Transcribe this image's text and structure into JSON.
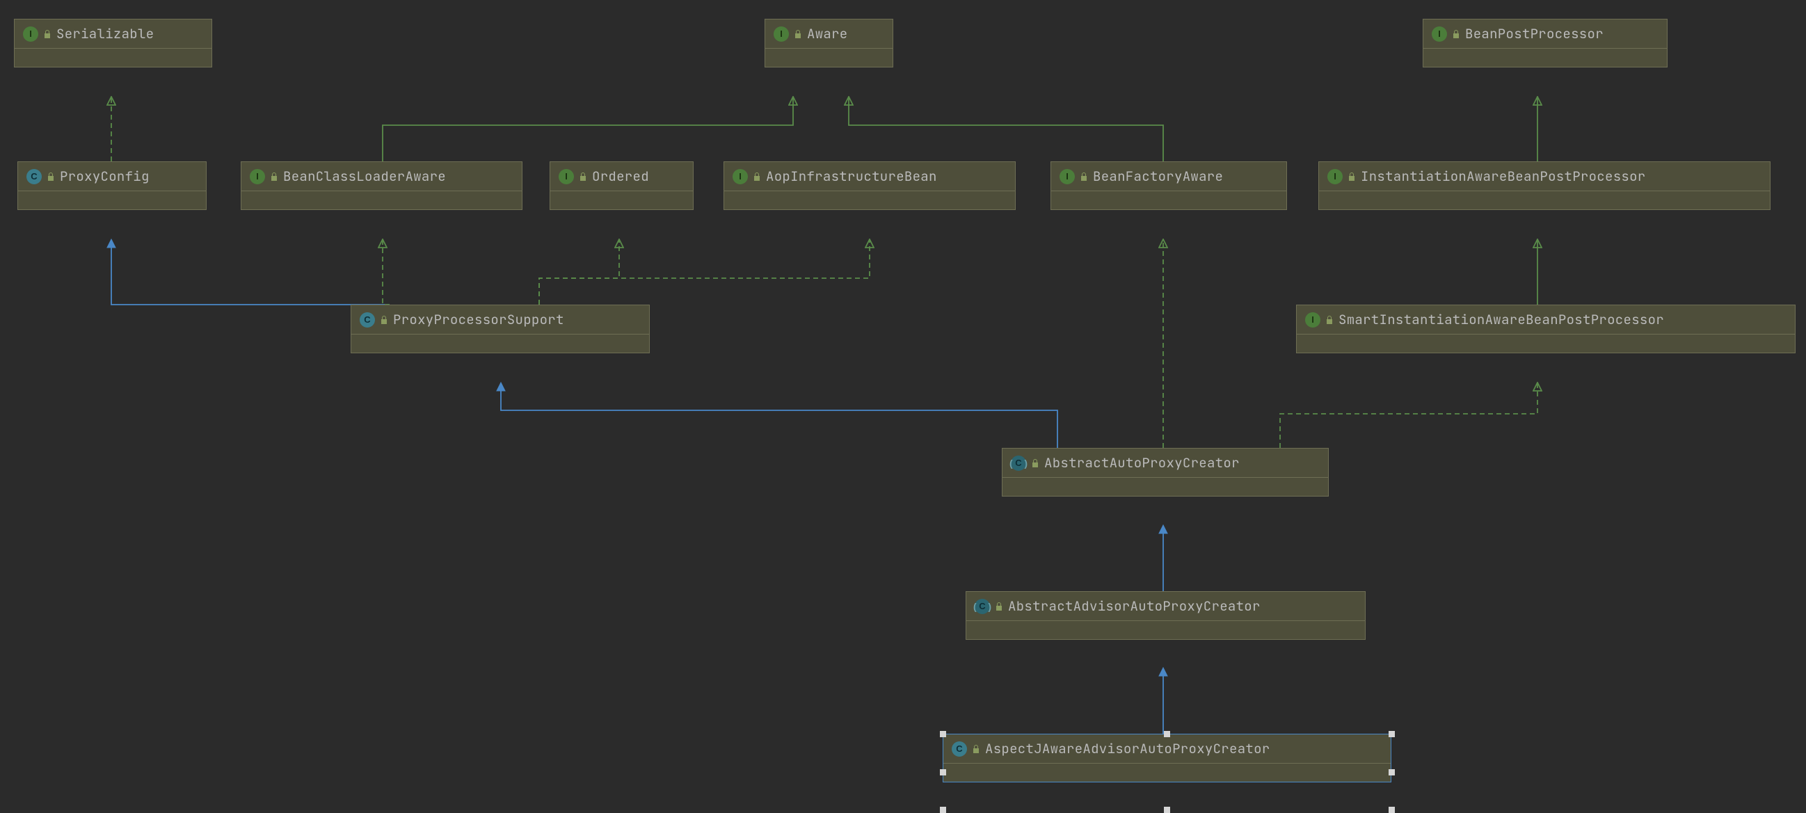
{
  "diagram_type": "UML Class Hierarchy",
  "colors": {
    "background": "#2b2b2b",
    "node_bg": "#4e4e3a",
    "node_border": "#6e6e54",
    "interface_icon": "#4b7d3a",
    "class_icon": "#3a7d8c",
    "extends_line": "#4a88c7",
    "implements_line": "#5a8c4a",
    "selection_border": "#4a88c7"
  },
  "nodes": {
    "serializable": {
      "name": "Serializable",
      "kind": "interface"
    },
    "aware": {
      "name": "Aware",
      "kind": "interface"
    },
    "beanPostProcessor": {
      "name": "BeanPostProcessor",
      "kind": "interface"
    },
    "proxyConfig": {
      "name": "ProxyConfig",
      "kind": "class"
    },
    "beanClassLoaderAware": {
      "name": "BeanClassLoaderAware",
      "kind": "interface"
    },
    "ordered": {
      "name": "Ordered",
      "kind": "interface"
    },
    "aopInfrastructureBean": {
      "name": "AopInfrastructureBean",
      "kind": "interface"
    },
    "beanFactoryAware": {
      "name": "BeanFactoryAware",
      "kind": "interface"
    },
    "instantiationAwareBeanPostProcessor": {
      "name": "InstantiationAwareBeanPostProcessor",
      "kind": "interface"
    },
    "proxyProcessorSupport": {
      "name": "ProxyProcessorSupport",
      "kind": "class"
    },
    "smartInstantiationAwareBeanPostProcessor": {
      "name": "SmartInstantiationAwareBeanPostProcessor",
      "kind": "interface"
    },
    "abstractAutoProxyCreator": {
      "name": "AbstractAutoProxyCreator",
      "kind": "abstract-class"
    },
    "abstractAdvisorAutoProxyCreator": {
      "name": "AbstractAdvisorAutoProxyCreator",
      "kind": "abstract-class"
    },
    "aspectJAwareAdvisorAutoProxyCreator": {
      "name": "AspectJAwareAdvisorAutoProxyCreator",
      "kind": "class",
      "selected": true
    }
  },
  "edges": [
    {
      "from": "proxyConfig",
      "to": "serializable",
      "rel": "implements"
    },
    {
      "from": "beanClassLoaderAware",
      "to": "aware",
      "rel": "extends-interface"
    },
    {
      "from": "beanFactoryAware",
      "to": "aware",
      "rel": "extends-interface"
    },
    {
      "from": "instantiationAwareBeanPostProcessor",
      "to": "beanPostProcessor",
      "rel": "extends-interface"
    },
    {
      "from": "proxyProcessorSupport",
      "to": "proxyConfig",
      "rel": "extends"
    },
    {
      "from": "proxyProcessorSupport",
      "to": "beanClassLoaderAware",
      "rel": "implements"
    },
    {
      "from": "proxyProcessorSupport",
      "to": "ordered",
      "rel": "implements"
    },
    {
      "from": "proxyProcessorSupport",
      "to": "aopInfrastructureBean",
      "rel": "implements"
    },
    {
      "from": "smartInstantiationAwareBeanPostProcessor",
      "to": "instantiationAwareBeanPostProcessor",
      "rel": "extends-interface"
    },
    {
      "from": "abstractAutoProxyCreator",
      "to": "proxyProcessorSupport",
      "rel": "extends"
    },
    {
      "from": "abstractAutoProxyCreator",
      "to": "beanFactoryAware",
      "rel": "implements"
    },
    {
      "from": "abstractAutoProxyCreator",
      "to": "smartInstantiationAwareBeanPostProcessor",
      "rel": "implements"
    },
    {
      "from": "abstractAdvisorAutoProxyCreator",
      "to": "abstractAutoProxyCreator",
      "rel": "extends"
    },
    {
      "from": "aspectJAwareAdvisorAutoProxyCreator",
      "to": "abstractAdvisorAutoProxyCreator",
      "rel": "extends"
    }
  ],
  "icon_labels": {
    "interface": "I",
    "class": "C",
    "abstract-class": "C"
  }
}
